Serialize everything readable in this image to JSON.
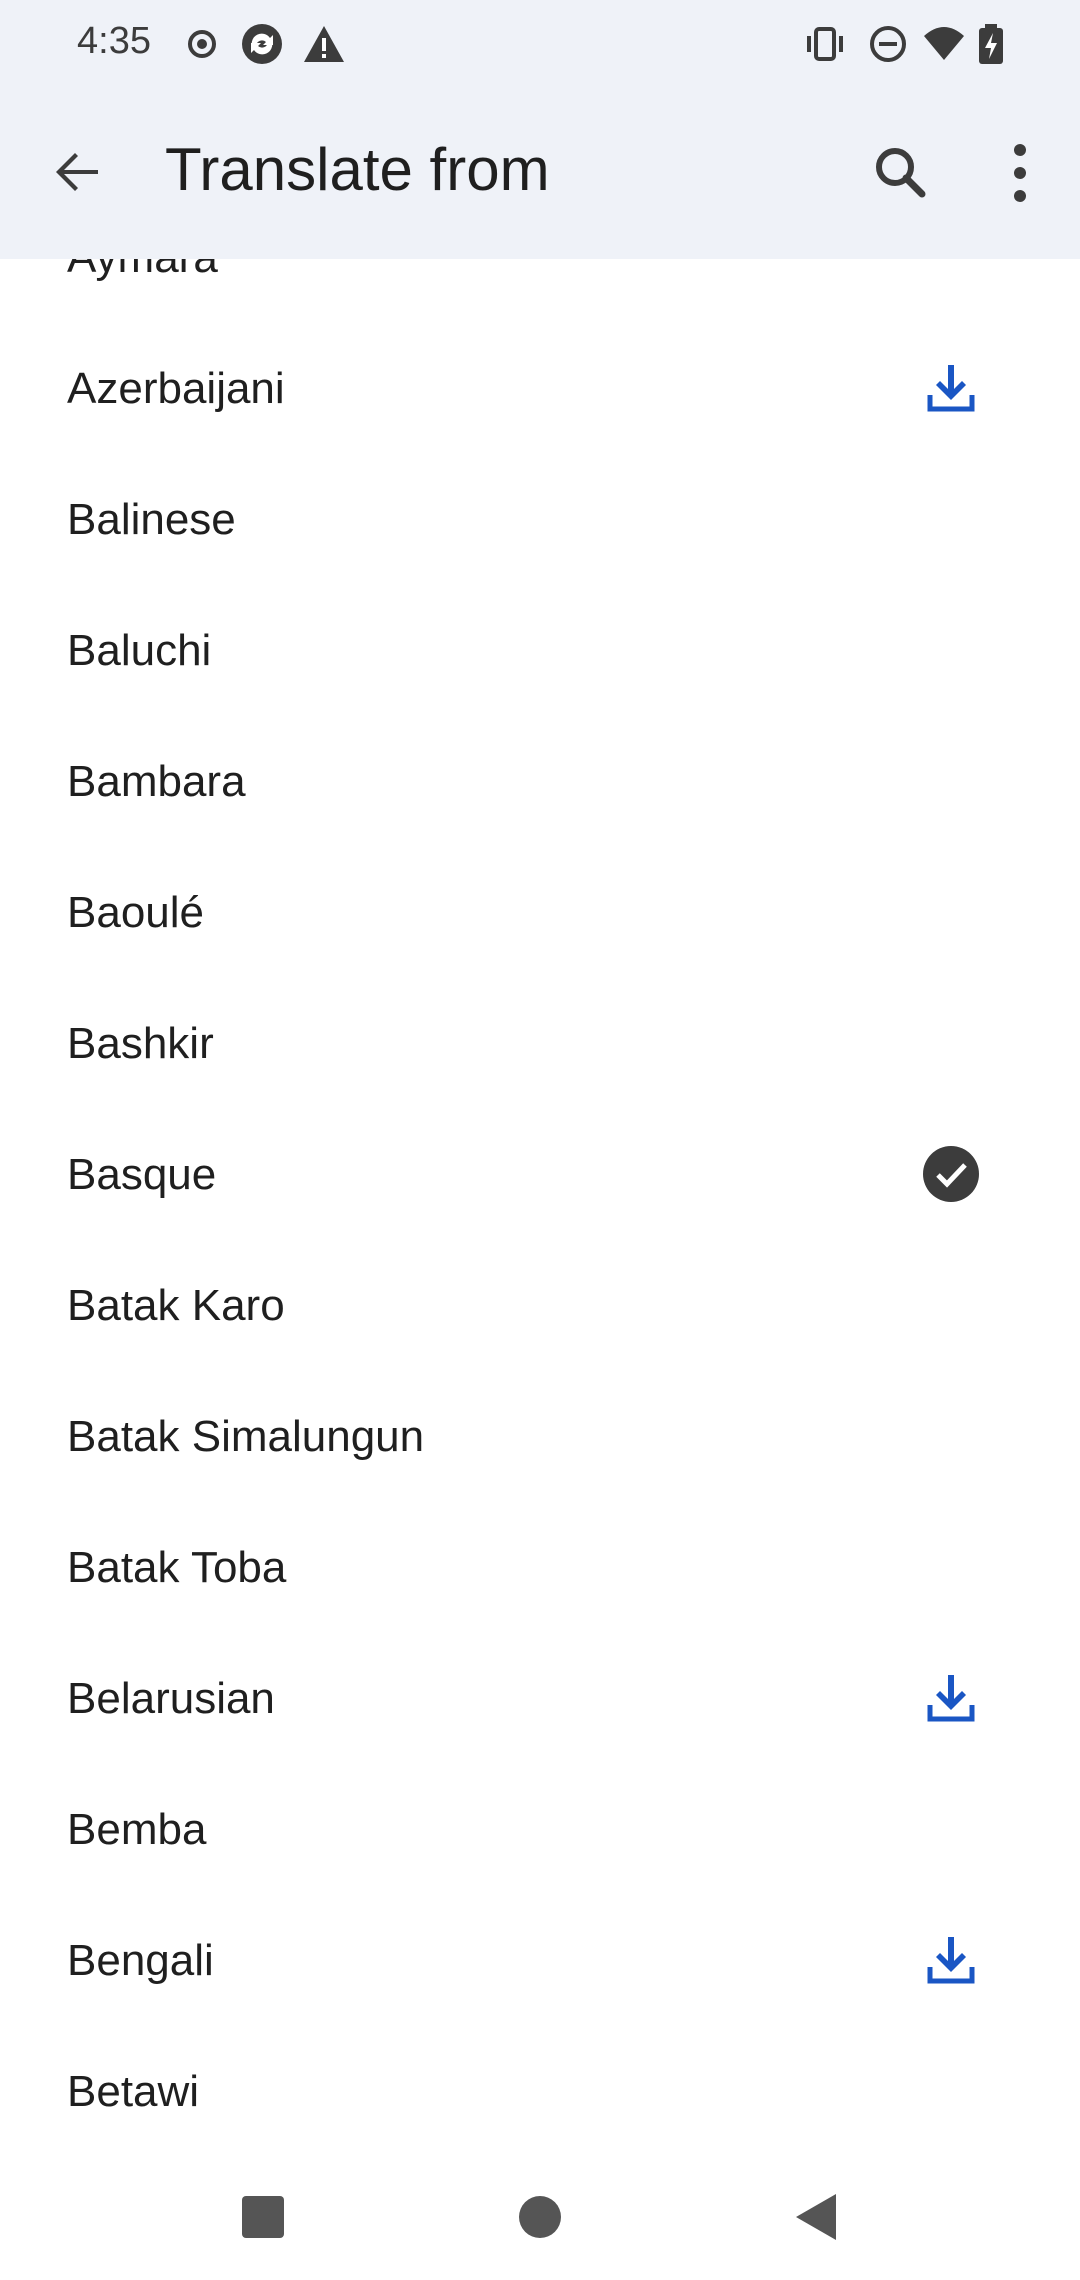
{
  "status_bar": {
    "time": "4:35",
    "left_icons": [
      "record-icon",
      "sync-icon",
      "alert-icon"
    ],
    "right_icons": [
      "vibrate-icon",
      "do-not-disturb-icon",
      "wifi-icon",
      "battery-charging-icon"
    ]
  },
  "app_bar": {
    "title": "Translate from",
    "back_icon": "arrow-back-icon",
    "search_icon": "search-icon",
    "more_icon": "more-vert-icon"
  },
  "languages": [
    {
      "label": "Aymara",
      "status": "none"
    },
    {
      "label": "Azerbaijani",
      "status": "download"
    },
    {
      "label": "Balinese",
      "status": "none"
    },
    {
      "label": "Baluchi",
      "status": "none"
    },
    {
      "label": "Bambara",
      "status": "none"
    },
    {
      "label": "Baoulé",
      "status": "none"
    },
    {
      "label": "Bashkir",
      "status": "none"
    },
    {
      "label": "Basque",
      "status": "downloaded"
    },
    {
      "label": "Batak Karo",
      "status": "none"
    },
    {
      "label": "Batak Simalungun",
      "status": "none"
    },
    {
      "label": "Batak Toba",
      "status": "none"
    },
    {
      "label": "Belarusian",
      "status": "download"
    },
    {
      "label": "Bemba",
      "status": "none"
    },
    {
      "label": "Bengali",
      "status": "download"
    },
    {
      "label": "Betawi",
      "status": "none"
    }
  ],
  "colors": {
    "app_bar_bg": "#eff2f8",
    "download_blue": "#1a56c4",
    "check_bg": "#3c3c3c"
  },
  "nav_bar": [
    "recents-square-icon",
    "home-circle-icon",
    "back-triangle-icon"
  ]
}
